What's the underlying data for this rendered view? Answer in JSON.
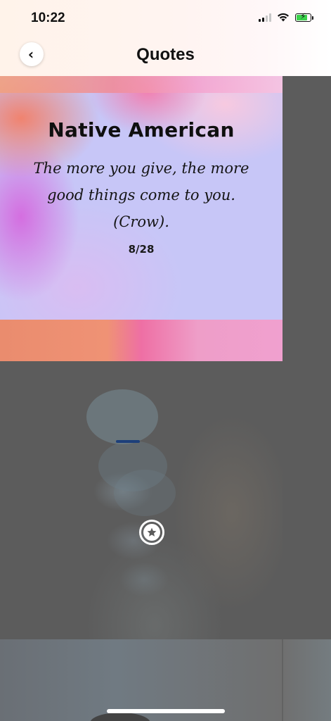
{
  "status_bar": {
    "time": "10:22",
    "icons": [
      "cellular-signal-icon",
      "wifi-icon",
      "battery-charging-icon"
    ]
  },
  "header": {
    "title": "Quotes",
    "back_icon": "chevron-left-icon"
  },
  "quote": {
    "heading": "Native American",
    "text": "The more you give, the more good things come to you. (Crow).",
    "counter": "8/28"
  },
  "actions": {
    "favorite_icon": "star-icon"
  },
  "colors": {
    "overlay": "#5b5b5b",
    "card_base": "#c7c6f7",
    "footer_orange": "#ea8c6e",
    "footer_pink": "#f0a0cf",
    "battery_green": "#3bd24c"
  }
}
